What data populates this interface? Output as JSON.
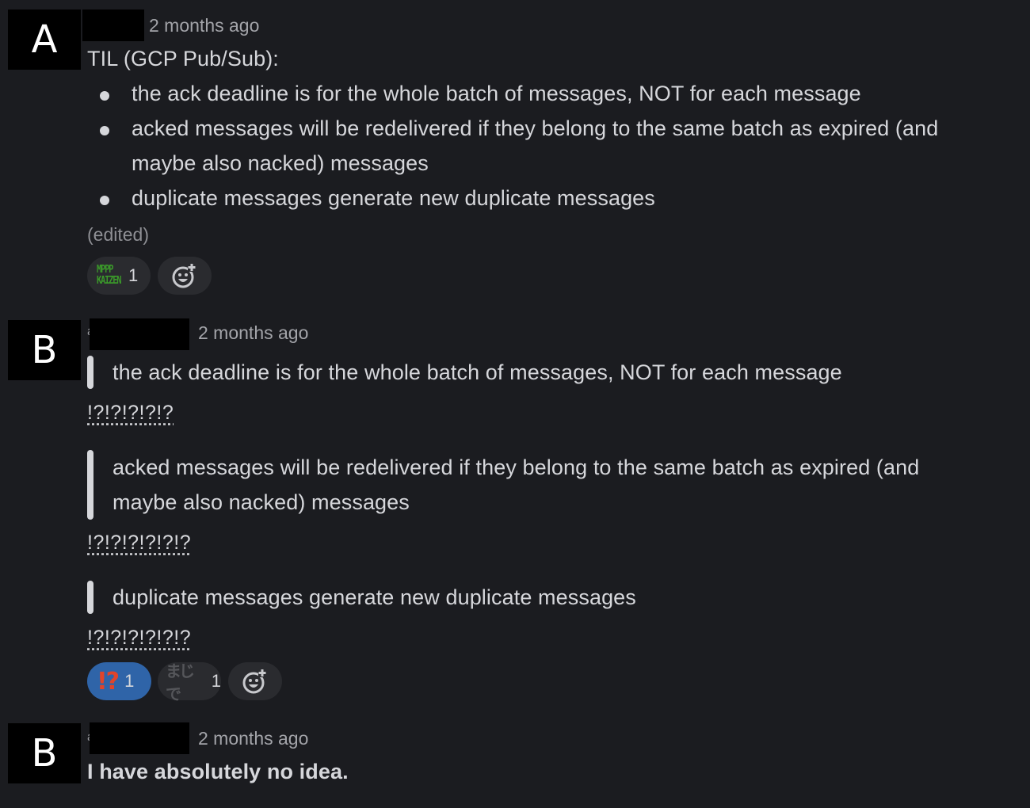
{
  "messages": [
    {
      "avatar_letter": "A",
      "name_stub": "",
      "timestamp": "2 months ago",
      "intro": "TIL (GCP Pub/Sub):",
      "bullets": [
        "the ack deadline is for the whole batch of messages, NOT for each message",
        "acked messages will be redelivered if they belong to the same batch as expired (and",
        "maybe also nacked) messages",
        "duplicate messages generate new duplicate messages"
      ],
      "edited_label": "(edited)",
      "reactions": [
        {
          "emoji": "mppp-kaizen",
          "emoji_text_top": "MPPP",
          "emoji_text_bottom": "KAIZEN",
          "count": "1",
          "active": false
        }
      ]
    },
    {
      "avatar_letter": "B",
      "name_stub": "a",
      "timestamp": "2 months ago",
      "quotes": [
        {
          "lines": [
            "the ack deadline is for the whole batch of messages, NOT for each message"
          ],
          "reply": "!?!?!?!?!?"
        },
        {
          "lines": [
            "acked messages will be redelivered if they belong to the same batch as expired (and",
            "maybe also nacked) messages"
          ],
          "reply": "!?!?!?!?!?!?"
        },
        {
          "lines": [
            "duplicate messages generate new duplicate messages"
          ],
          "reply": "!?!?!?!?!?!?"
        }
      ],
      "reactions": [
        {
          "emoji": "interrobang",
          "emoji_text": "⁉",
          "count": "1",
          "active": true
        },
        {
          "emoji": "majide",
          "emoji_text": "まじで",
          "count": "1",
          "active": false
        }
      ]
    },
    {
      "avatar_letter": "B",
      "name_stub": "a",
      "timestamp": "2 months ago",
      "text": "I have absolutely no idea."
    }
  ],
  "colors": {
    "background": "#1b1c20",
    "text": "#d6d7db",
    "timestamp": "#a3a4a9",
    "reaction_active": "#2f64a8",
    "reaction_bg": "#2a2b2f",
    "interrobang_red": "#e0442a",
    "kaizen_green": "#3b9a2a"
  }
}
